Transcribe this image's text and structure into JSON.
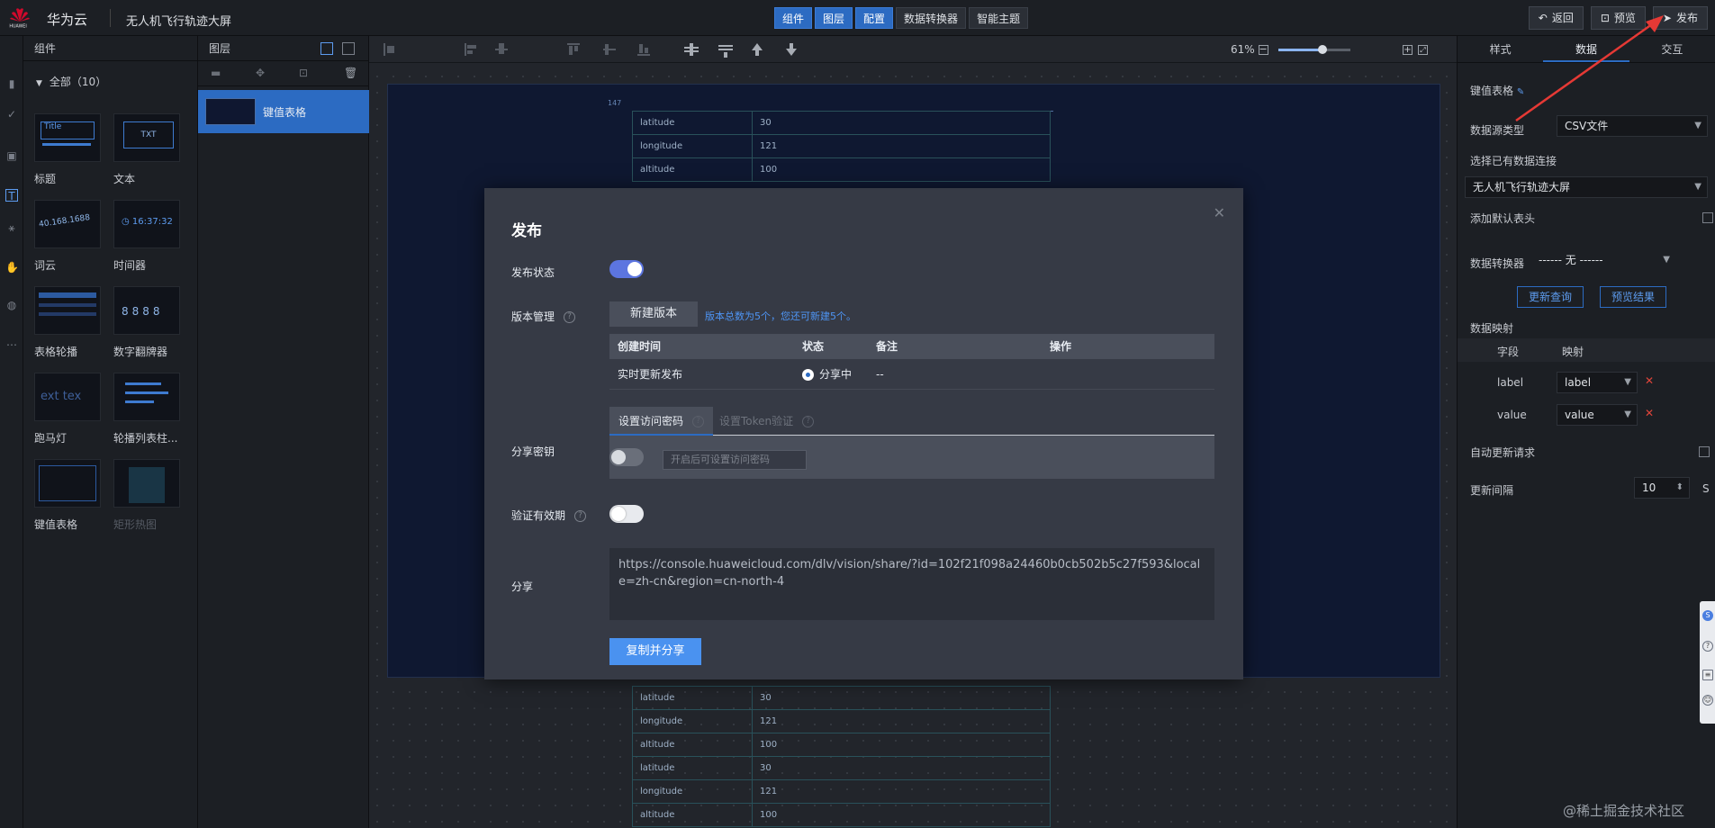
{
  "topbar": {
    "brand": "华为云",
    "logo_text": "HUAWEI",
    "project": "无人机飞行轨迹大屏",
    "center_tabs": [
      "组件",
      "图层",
      "配置",
      "数据转换器",
      "智能主题"
    ],
    "back": "返回",
    "preview": "预览",
    "publish": "发布"
  },
  "components": {
    "title": "组件",
    "all": "全部（10）",
    "items": [
      {
        "label": "标题",
        "thumb_text": "Title"
      },
      {
        "label": "文本",
        "thumb_text": "TXT"
      },
      {
        "label": "词云",
        "thumb_text": "40.168.1688"
      },
      {
        "label": "时间器",
        "thumb_text": "16:37:32"
      },
      {
        "label": "表格轮播",
        "thumb_text": ""
      },
      {
        "label": "数字翻牌器",
        "thumb_text": "8888"
      },
      {
        "label": "跑马灯",
        "thumb_text": "ext tex"
      },
      {
        "label": "轮播列表柱...",
        "thumb_text": ""
      },
      {
        "label": "键值表格",
        "thumb_text": ""
      },
      {
        "label": "矩形热图",
        "thumb_text": ""
      }
    ]
  },
  "layers": {
    "title": "图层",
    "item": "键值表格"
  },
  "canvas": {
    "zoom": "61%",
    "zoom_level": 0.61,
    "ruler_mark": "147",
    "top_rows": [
      [
        "latitude",
        "30"
      ],
      [
        "longitude",
        "121"
      ],
      [
        "altitude",
        "100"
      ]
    ],
    "bottom_rows": [
      [
        "latitude",
        "30"
      ],
      [
        "longitude",
        "121"
      ],
      [
        "altitude",
        "100"
      ],
      [
        "latitude",
        "30"
      ],
      [
        "longitude",
        "121"
      ],
      [
        "altitude",
        "100"
      ]
    ]
  },
  "right_panel": {
    "tabs": [
      "样式",
      "数据",
      "交互"
    ],
    "component_name": "键值表格",
    "source_type_label": "数据源类型",
    "source_type_value": "CSV文件",
    "existing_conn_label": "选择已有数据连接",
    "existing_conn_value": "无人机飞行轨迹大屏",
    "default_header_label": "添加默认表头",
    "converter_label": "数据转换器",
    "converter_value": "------ 无 ------",
    "update_query": "更新查询",
    "preview_result": "预览结果",
    "mapping_label": "数据映射",
    "col_field": "字段",
    "col_map": "映射",
    "mappings": [
      {
        "field": "label",
        "map": "label"
      },
      {
        "field": "value",
        "map": "value"
      }
    ],
    "auto_update_label": "自动更新请求",
    "interval_label": "更新间隔",
    "interval_value": "10",
    "interval_unit": "S"
  },
  "modal": {
    "title": "发布",
    "status_label": "发布状态",
    "status_on": true,
    "version_label": "版本管理",
    "new_version": "新建版本",
    "version_hint": "版本总数为5个，您还可新建5个。",
    "table_headers": [
      "创建时间",
      "状态",
      "备注",
      "操作"
    ],
    "table_row": {
      "time": "实时更新发布",
      "status": "分享中",
      "note": "--",
      "op": ""
    },
    "share_key_label": "分享密钥",
    "tab_password": "设置访问密码",
    "tab_token": "设置Token验证",
    "password_placeholder": "开启后可设置访问密码",
    "validity_label": "验证有效期",
    "share_label": "分享",
    "share_url": "https://console.huaweicloud.com/dlv/vision/share/?id=102f21f098a24460b0cb502b5c27f593&locale=zh-cn&region=cn-north-4",
    "copy_share": "复制并分享",
    "accent_color": "#4a92f0"
  },
  "watermark": "@稀土掘金技术社区"
}
